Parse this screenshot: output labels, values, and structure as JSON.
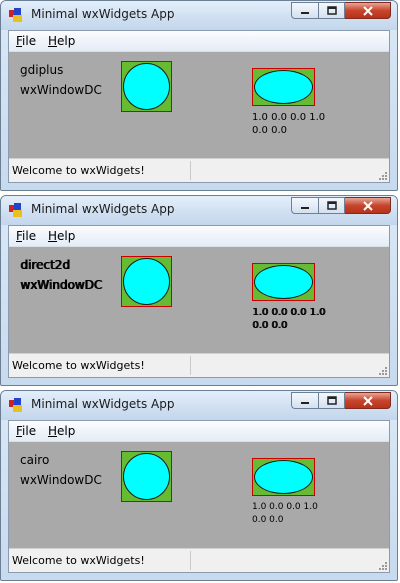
{
  "windows": [
    {
      "title": "Minimal wxWidgets App",
      "menu": {
        "file_accel": "F",
        "file_rest": "ile",
        "help_accel": "H",
        "help_rest": "elp"
      },
      "renderer": "gdiplus",
      "dc_label": "wxWindowDC",
      "matrix_line1": "1.0 0.0 0.0 1.0",
      "matrix_line2": "0.0 0.0",
      "status": "Welcome to wxWidgets!"
    },
    {
      "title": "Minimal wxWidgets App",
      "menu": {
        "file_accel": "F",
        "file_rest": "ile",
        "help_accel": "H",
        "help_rest": "elp"
      },
      "renderer": "direct2d",
      "dc_label": "wxWindowDC",
      "matrix_line1": "1.0 0.0 0.0 1.0",
      "matrix_line2": "0.0 0.0",
      "status": "Welcome to wxWidgets!"
    },
    {
      "title": "Minimal wxWidgets App",
      "menu": {
        "file_accel": "F",
        "file_rest": "ile",
        "help_accel": "H",
        "help_rest": "elp"
      },
      "renderer": "cairo",
      "dc_label": "wxWindowDC",
      "matrix_line1": "1.0 0.0 0.0 1.0",
      "matrix_line2": "0.0 0.0",
      "status": "Welcome to wxWidgets!"
    }
  ],
  "colors": {
    "canvas_bg": "#a9a9a9",
    "shape_fill": "#00ffff",
    "shape_bg": "#66bb33",
    "shape_border": "#cc0000",
    "close_button": "#c7452c"
  },
  "icons": [
    "app-icon",
    "minimize-icon",
    "maximize-icon",
    "close-icon",
    "size-grip-icon"
  ]
}
